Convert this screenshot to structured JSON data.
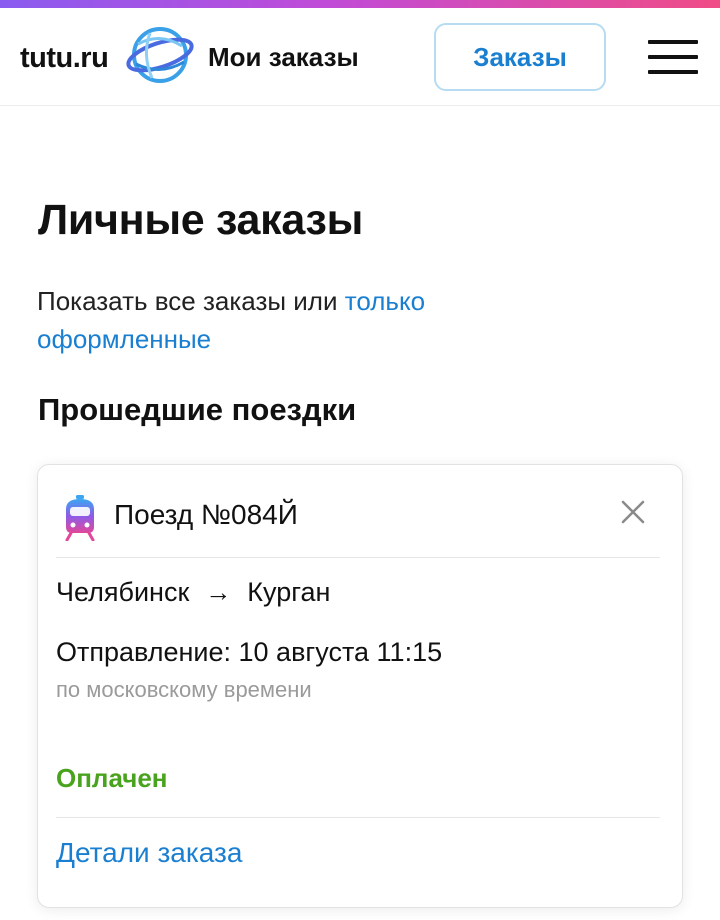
{
  "header": {
    "logo_text": "tutu.ru",
    "title": "Мои заказы",
    "orders_button_label": "Заказы"
  },
  "page": {
    "title": "Личные заказы",
    "filter_prefix": "Показать все заказы или ",
    "filter_link": "только оформленные",
    "section_title": "Прошедшие поездки"
  },
  "order": {
    "train_name": "Поезд №084Й",
    "from": "Челябинск",
    "arrow": "→",
    "to": "Курган",
    "departure": "Отправление: 10 августа 11:15",
    "timezone_note": "по московскому времени",
    "status": "Оплачен",
    "details_link": "Детали заказа"
  },
  "icons": {
    "logo": "globe-logo-icon",
    "menu": "hamburger-menu-icon",
    "train": "train-icon",
    "close": "close-icon"
  },
  "colors": {
    "accent_blue": "#1a7fd0",
    "status_green": "#4aa31f",
    "muted_gray": "#9a9a9a",
    "top_gradient_start": "#8a5cf0",
    "top_gradient_end": "#f04c86"
  }
}
